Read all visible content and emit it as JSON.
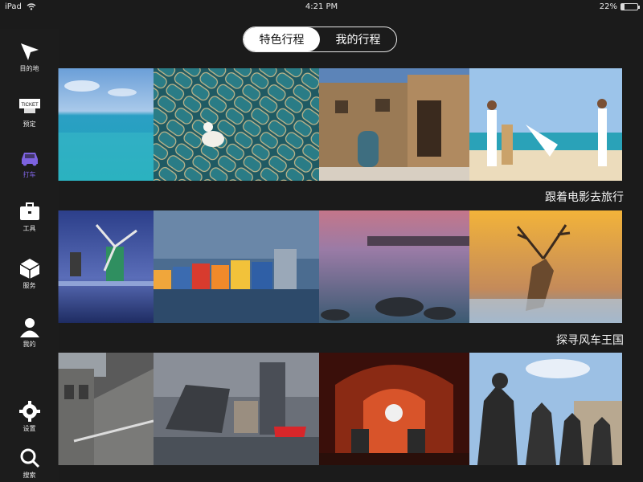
{
  "status_bar": {
    "device": "iPad",
    "time": "4:21 PM",
    "battery": "22%",
    "battery_level": 0.22
  },
  "tabs": [
    {
      "label": "特色行程",
      "active": true
    },
    {
      "label": "我的行程",
      "active": false
    }
  ],
  "sections": [
    {
      "caption": "跟着电影去旅行",
      "photos": [
        "ocean-water",
        "mosque-prayer-carpet",
        "old-stone-building",
        "beach-capoeira"
      ]
    },
    {
      "caption": "探寻风车王国",
      "photos": [
        "windmill-dusk",
        "colorful-waterfront-houses",
        "rocky-shore-sunset",
        "deer-sunset"
      ]
    },
    {
      "caption": "",
      "photos": [
        "state-house-facade",
        "dock-buildings-red-ship",
        "cavern-club-stage",
        "beatles-statues"
      ]
    }
  ],
  "sidebar": {
    "accent_color": "#7d63e0",
    "items": [
      {
        "label": "目的地",
        "icon": "paper-plane-icon",
        "active": false
      },
      {
        "label": "预定",
        "icon": "ticket-icon",
        "icon_text": "TICKET",
        "active": false
      },
      {
        "label": "打车",
        "icon": "car-icon",
        "active": true
      },
      {
        "label": "工具",
        "icon": "toolbox-icon",
        "active": false
      },
      {
        "label": "服务",
        "icon": "cube-icon",
        "active": false
      },
      {
        "label": "我的",
        "icon": "person-icon",
        "active": false
      },
      {
        "label": "设置",
        "icon": "gear-icon",
        "active": false
      },
      {
        "label": "搜索",
        "icon": "search-icon",
        "active": false
      }
    ]
  }
}
